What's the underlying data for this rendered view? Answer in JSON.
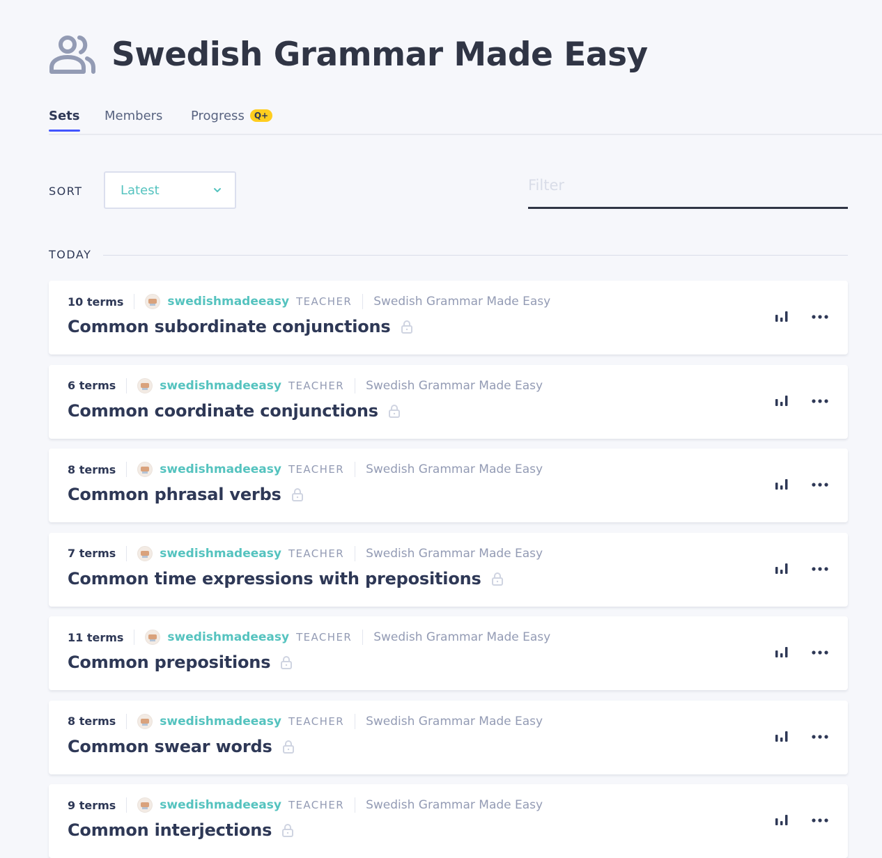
{
  "header": {
    "title": "Swedish Grammar Made Easy",
    "icon": "group-icon"
  },
  "tabs": [
    {
      "label": "Sets",
      "active": true
    },
    {
      "label": "Members",
      "active": false
    },
    {
      "label": "Progress",
      "active": false,
      "badge": "Q+"
    }
  ],
  "controls": {
    "sort_label": "SORT",
    "sort_value": "Latest",
    "filter_placeholder": "Filter"
  },
  "section": {
    "label": "TODAY"
  },
  "colors": {
    "accent": "#4255ff",
    "username": "#55c3bf",
    "badge": "#ffcd1f",
    "text": "#2e3856",
    "muted": "#939bb4"
  },
  "sets": [
    {
      "terms": "10 terms",
      "user": "swedishmadeeasy",
      "role": "TEACHER",
      "folder": "Swedish Grammar Made Easy",
      "title": "Common subordinate conjunctions"
    },
    {
      "terms": "6 terms",
      "user": "swedishmadeeasy",
      "role": "TEACHER",
      "folder": "Swedish Grammar Made Easy",
      "title": "Common coordinate conjunctions"
    },
    {
      "terms": "8 terms",
      "user": "swedishmadeeasy",
      "role": "TEACHER",
      "folder": "Swedish Grammar Made Easy",
      "title": "Common phrasal verbs"
    },
    {
      "terms": "7 terms",
      "user": "swedishmadeeasy",
      "role": "TEACHER",
      "folder": "Swedish Grammar Made Easy",
      "title": "Common time expressions with prepositions"
    },
    {
      "terms": "11 terms",
      "user": "swedishmadeeasy",
      "role": "TEACHER",
      "folder": "Swedish Grammar Made Easy",
      "title": "Common prepositions"
    },
    {
      "terms": "8 terms",
      "user": "swedishmadeeasy",
      "role": "TEACHER",
      "folder": "Swedish Grammar Made Easy",
      "title": "Common swear words"
    },
    {
      "terms": "9 terms",
      "user": "swedishmadeeasy",
      "role": "TEACHER",
      "folder": "Swedish Grammar Made Easy",
      "title": "Common interjections"
    }
  ]
}
